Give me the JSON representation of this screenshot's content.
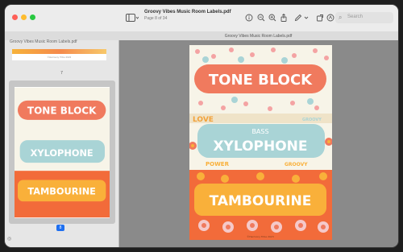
{
  "window": {
    "title": "Groovy Vibes Music Room Labels.pdf",
    "subtitle": "Page 8 of 34",
    "content_header": "Groovy Vibes Music Room Labels.pdf",
    "sidebar_header": "Groovy Vibes Music Room Labels.pdf"
  },
  "toolbar": {
    "search_placeholder": "Search",
    "icons": [
      "sidebar-toggle",
      "info",
      "zoom-out",
      "zoom-in",
      "share",
      "markup",
      "markup-menu",
      "rotate",
      "annotate"
    ]
  },
  "sidebar": {
    "prev_page_number": "7",
    "current_page_number": "8"
  },
  "page": {
    "labels": [
      "TONE BLOCK",
      "BASS",
      "XYLOPHONE",
      "TAMBOURINE"
    ],
    "decor_words": [
      "LOVE",
      "GROOVY",
      "POWER",
      "GROOVY"
    ],
    "footer": "©Harmony Tribe 2023"
  },
  "colors": {
    "tone_block_bg": "#f7f4e8",
    "tone_block_pill": "#f07a5e",
    "xylophone_pill": "#a9d4d6",
    "tambourine_bg": "#f26b3a",
    "tambourine_pill": "#f9b03a",
    "accent": "#1e6ff0"
  }
}
